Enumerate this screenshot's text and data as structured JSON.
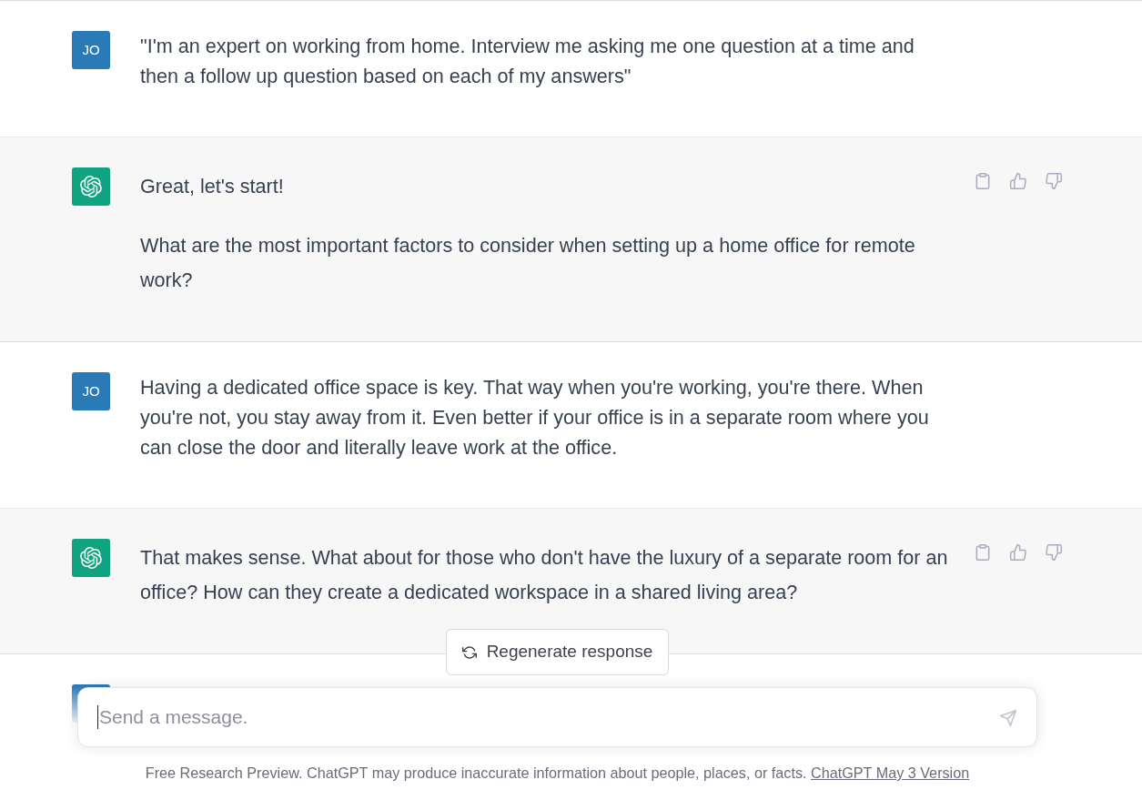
{
  "messages": [
    {
      "kind": "user",
      "avatar": "JO",
      "paragraphs": [
        "\"I'm an expert on working from home. Interview me asking me one question at a time and then a follow up question based on each of my answers\""
      ]
    },
    {
      "kind": "assistant",
      "paragraphs": [
        "Great, let's start!",
        "What are the most important factors to consider when setting up a home office for remote work?"
      ]
    },
    {
      "kind": "user",
      "avatar": "JO",
      "paragraphs": [
        "Having a dedicated office space is key. That way when you're working, you're there. When you're not, you stay away from it. Even better if your office is in a separate room where you can close the door and literally leave work at the office."
      ]
    },
    {
      "kind": "assistant",
      "paragraphs": [
        "That makes sense. What about for those who don't have the luxury of a separate room for an office? How can they create a dedicated workspace in a shared living area?"
      ]
    },
    {
      "kind": "user"
    }
  ],
  "regenerate_button": {
    "label": "Regenerate response"
  },
  "composer": {
    "placeholder": "Send a message."
  },
  "footer": {
    "text": "Free Research Preview. ChatGPT may produce inaccurate information about people, places, or facts.",
    "link": "ChatGPT May 3 Version"
  }
}
